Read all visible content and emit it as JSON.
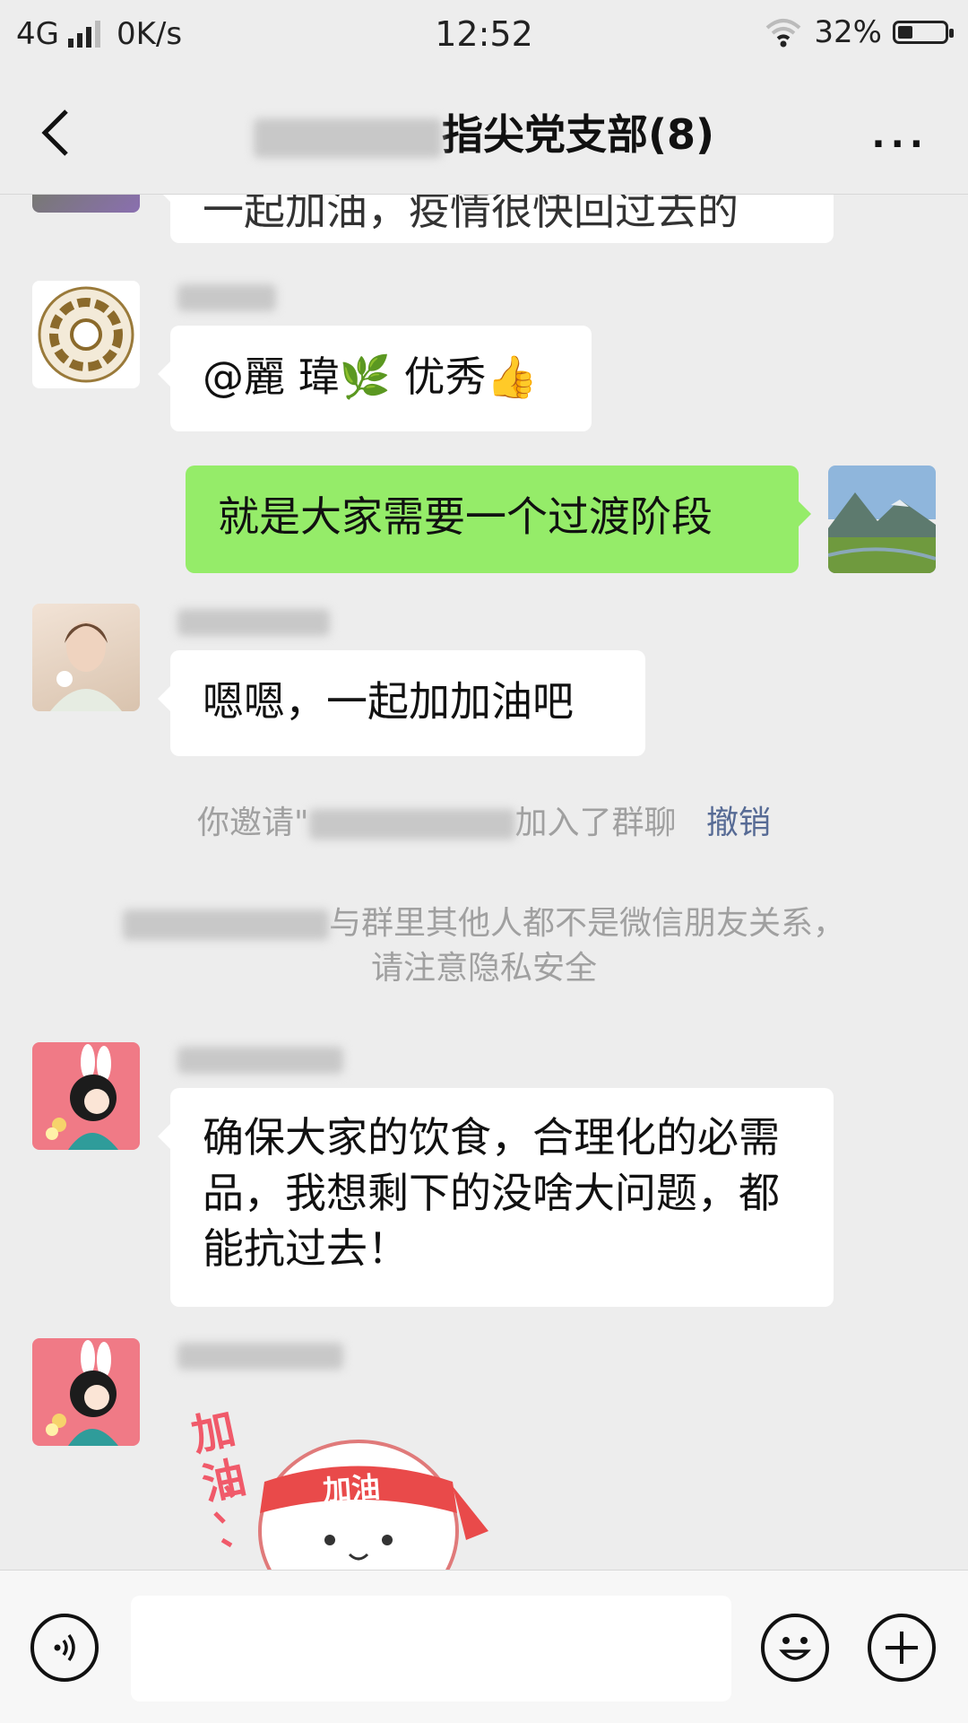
{
  "status_bar": {
    "network": "4G",
    "speed": "0K/s",
    "time": "12:52",
    "battery_percent": "32%",
    "battery_level": 0.32
  },
  "nav": {
    "title_suffix": "指尖党支部(8)",
    "more": "···"
  },
  "messages": {
    "m0_text": "一起加油，疫情很快回过去的",
    "m1_text": "@麗 瑋🌿  优秀👍",
    "m2_text": "就是大家需要一个过渡阶段",
    "m3_text": "嗯嗯，一起加加油吧",
    "sys1_prefix": "你邀请\"",
    "sys1_suffix": "加入了群聊",
    "sys1_link": "撤销",
    "sys2_line1": "与群里其他人都不是微信朋友关系，",
    "sys2_line2": "请注意隐私安全",
    "m4_text": "确保大家的饮食，合理化的必需品，我想剩下的没啥大问题，都能抗过去！",
    "sticker_side": "加油",
    "sticker_band": "加油"
  },
  "colors": {
    "background": "#ededed",
    "sent_bubble": "#95ec69",
    "link": "#576b95"
  },
  "icons": [
    "back-icon",
    "more-icon",
    "voice-icon",
    "emoji-icon",
    "plus-icon"
  ]
}
